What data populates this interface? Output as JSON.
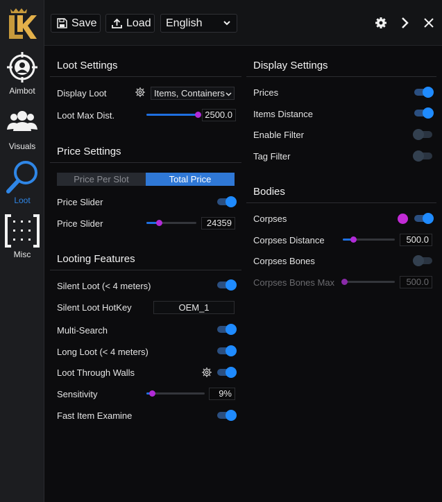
{
  "logo": {
    "letters": "LK"
  },
  "sidebar": {
    "items": [
      {
        "label": "Aimbot",
        "icon": "crosshair-user-icon"
      },
      {
        "label": "Visuals",
        "icon": "users-icon"
      },
      {
        "label": "Loot",
        "icon": "search-icon",
        "active": true
      },
      {
        "label": "Misc",
        "icon": "grid-bracket-icon"
      }
    ]
  },
  "toolbar": {
    "save_label": "Save",
    "load_label": "Load",
    "language": "English"
  },
  "loot_settings": {
    "title": "Loot Settings",
    "display_loot_label": "Display Loot",
    "display_loot_value": "Items, Containers",
    "max_dist_label": "Loot Max Dist.",
    "max_dist_value": "2500.0",
    "max_dist_fraction": 1.0
  },
  "price_settings": {
    "title": "Price Settings",
    "seg_per_slot": "Price Per Slot",
    "seg_total": "Total Price",
    "price_slider_label": "Price Slider",
    "price_slider_on": true,
    "price_label": "Price Slider",
    "price_value": "24359",
    "price_fraction": 0.25
  },
  "looting_features": {
    "title": "Looting Features",
    "silent_loot_label": "Silent Loot (< 4 meters)",
    "hotkey_label": "Silent Loot HotKey",
    "hotkey_value": "OEM_1",
    "multi_search_label": "Multi-Search",
    "long_loot_label": "Long Loot (< 4 meters)",
    "through_walls_label": "Loot Through Walls",
    "sensitivity_label": "Sensitivity",
    "sensitivity_value": "9%",
    "sensitivity_fraction": 0.09,
    "fast_examine_label": "Fast Item Examine"
  },
  "display_settings": {
    "title": "Display Settings",
    "prices_label": "Prices",
    "items_distance_label": "Items Distance",
    "enable_filter_label": "Enable Filter",
    "tag_filter_label": "Tag Filter"
  },
  "bodies": {
    "title": "Bodies",
    "corpses_label": "Corpses",
    "corpses_color": "#c22bd6",
    "corpses_distance_label": "Corpses Distance",
    "corpses_distance_value": "500.0",
    "corpses_distance_fraction": 0.2,
    "corpses_bones_label": "Corpses Bones",
    "corpses_bones_max_label": "Corpses Bones Max",
    "corpses_bones_max_value": "500.0",
    "corpses_bones_max_fraction": 0.0
  },
  "colors": {
    "accent": "#1f8bff",
    "slider_thumb": "#b12bd6",
    "active_segment": "#2f78d6"
  }
}
